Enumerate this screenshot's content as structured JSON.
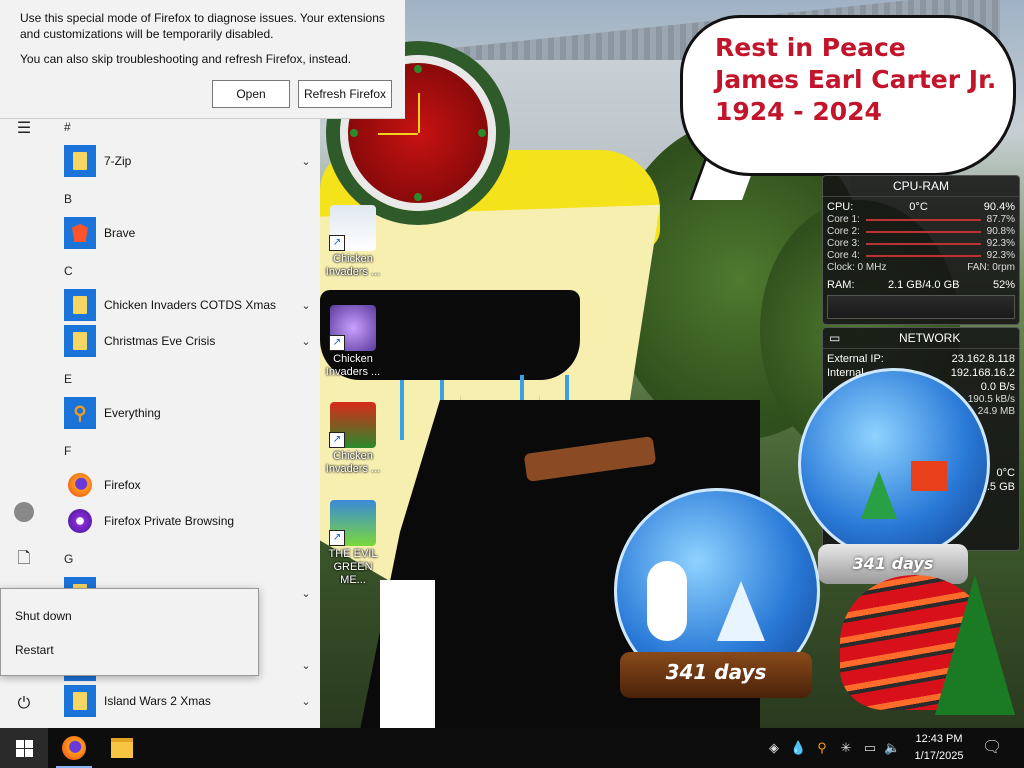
{
  "notification": {
    "line1": "Use this special mode of Firefox to diagnose issues. Your extensions",
    "line2": "and customizations will be temporarily disabled.",
    "line3": "You can also skip troubleshooting and refresh Firefox, instead.",
    "open_label": "Open",
    "refresh_label": "Refresh Firefox"
  },
  "start_menu": {
    "groups": [
      {
        "letter": "#",
        "apps": [
          {
            "label": "7-Zip",
            "icon": "folder-icon",
            "expandable": true
          }
        ]
      },
      {
        "letter": "B",
        "apps": [
          {
            "label": "Brave",
            "icon": "brave-icon",
            "expandable": false
          }
        ]
      },
      {
        "letter": "C",
        "apps": [
          {
            "label": "Chicken Invaders COTDS Xmas",
            "icon": "folder-icon",
            "expandable": true
          },
          {
            "label": "Christmas Eve Crisis",
            "icon": "folder-icon",
            "expandable": true
          }
        ]
      },
      {
        "letter": "E",
        "apps": [
          {
            "label": "Everything",
            "icon": "search-icon",
            "expandable": false
          }
        ]
      },
      {
        "letter": "F",
        "apps": [
          {
            "label": "Firefox",
            "icon": "firefox-icon",
            "expandable": false
          },
          {
            "label": "Firefox Private Browsing",
            "icon": "private-browsing-icon",
            "expandable": false
          }
        ]
      },
      {
        "letter": "G",
        "apps": []
      }
    ],
    "last_app": {
      "label": "Island Wars 2 Xmas",
      "icon": "folder-icon",
      "expandable": true
    }
  },
  "power_menu": {
    "shutdown_label": "Shut down",
    "restart_label": "Restart"
  },
  "speech_bubble": {
    "line1": "Rest in Peace",
    "line2": "James Earl Carter Jr.",
    "line3": "1924 - 2024"
  },
  "desktop_icons": [
    {
      "label_line1": "Chicken",
      "label_line2": "Invaders ..."
    },
    {
      "label_line1": "Chicken",
      "label_line2": "Invaders ..."
    },
    {
      "label_line1": "Chicken",
      "label_line2": "Invaders ..."
    },
    {
      "label_line1": "THE EVIL",
      "label_line2": "GREEN ME..."
    }
  ],
  "cpu_gadget": {
    "title": "CPU-RAM",
    "cpu_label": "CPU:",
    "cpu_temp": "0°C",
    "cpu_value": "90.4%",
    "cores": [
      {
        "label": "Core 1:",
        "value": "87.7%"
      },
      {
        "label": "Core 2:",
        "value": "90.8%"
      },
      {
        "label": "Core 3:",
        "value": "92.3%"
      },
      {
        "label": "Core 4:",
        "value": "92.3%"
      }
    ],
    "clock": "Clock: 0 MHz",
    "fan": "FAN: 0rpm",
    "ram_label": "RAM:",
    "ram_value": "2.1 GB/4.0 GB",
    "ram_percent": "52%"
  },
  "network_gadget": {
    "title": "NETWORK",
    "external_ip_label": "External IP:",
    "external_ip": "23.162.8.118",
    "internal_label": "Internal",
    "internal_ip": "192.168.16.2",
    "row3_value": "0.0 B/s",
    "row4_value": "190.5 kB/s",
    "row5_value": "24.9 MB",
    "temp": "0°C",
    "storage": "9.5 GB"
  },
  "snow_globes": {
    "large_days": "341 days",
    "small_days": "341 days"
  },
  "taskbar": {
    "time": "12:43 PM",
    "date": "1/17/2025"
  }
}
